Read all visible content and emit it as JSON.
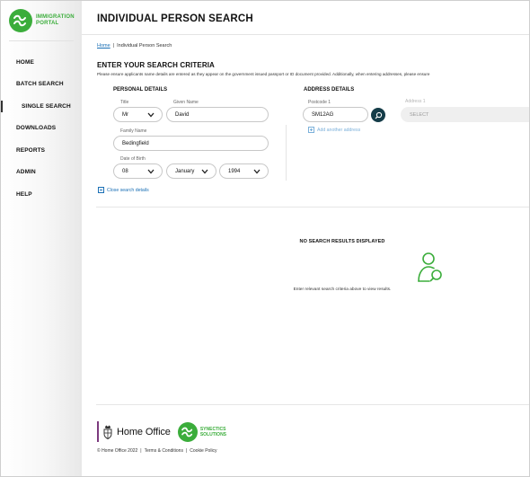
{
  "sidebar": {
    "logo": {
      "line1": "IMMIGRATION",
      "line2": "PORTAL"
    },
    "items": [
      {
        "label": "HOME"
      },
      {
        "label": "BATCH SEARCH"
      },
      {
        "label": "SINGLE SEARCH"
      },
      {
        "label": "DOWNLOADS"
      },
      {
        "label": "REPORTS"
      },
      {
        "label": "ADMIN"
      },
      {
        "label": "HELP"
      }
    ],
    "active_item": "SINGLE SEARCH"
  },
  "header": {
    "title": "INDIVIDUAL PERSON SEARCH"
  },
  "breadcrumb": {
    "home": "Home",
    "separator": "|",
    "current": "Individual Person Search"
  },
  "criteria": {
    "title": "ENTER YOUR SEARCH CRITERIA",
    "instructions": "Please ensure applicants name details are entered as they appear on the government issued passport or ID document provided. Additionally, when entering addresses, please ensure"
  },
  "personal": {
    "title": "PERSONAL DETAILS",
    "title_label": "Title",
    "title_value": "Mr",
    "given_label": "Given Name",
    "given_value": "David",
    "family_label": "Family Name",
    "family_value": "Bedingfield",
    "dob_label": "Date of Birth",
    "dob_day": "08",
    "dob_month": "January",
    "dob_year": "1994"
  },
  "address": {
    "title": "ADDRESS DETAILS",
    "postcode_label": "Postcode 1",
    "postcode_value": "SM12AG",
    "address_label": "Address 1",
    "address_placeholder": "SELECT",
    "add_another": "Add another address"
  },
  "close_search": "Close search details",
  "results": {
    "title": "NO SEARCH RESULTS DISPLAYED",
    "message": "Enter relevant search criteria above to view results."
  },
  "footer": {
    "home_office": "Home Office",
    "synectics_line1": "SYNECTICS",
    "synectics_line2": "SOLUTIONS",
    "copyright": "© Home Office 2022",
    "terms": "Terms & Conditions",
    "cookie": "Cookie Policy",
    "separator": "|"
  },
  "colors": {
    "brand_green": "#3bad3b",
    "search_button": "#143c48",
    "link_blue": "#1a6fb5",
    "home_office_purple": "#7c3a7e"
  },
  "icons": {
    "logo": "immigration-portal-logo",
    "search": "search-icon",
    "add": "plus-box-icon",
    "close": "minus-box-icon",
    "person": "person-pin-icon",
    "crest": "home-office-crest-icon"
  }
}
